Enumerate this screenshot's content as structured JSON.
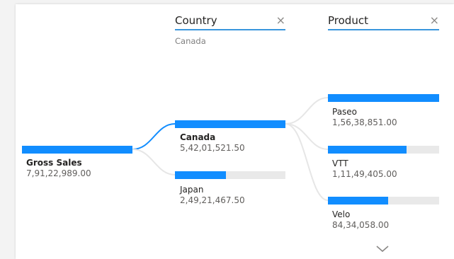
{
  "columns": [
    {
      "title": "Country",
      "close_symbol": "×",
      "filter_value": "Canada"
    },
    {
      "title": "Product",
      "close_symbol": "×"
    }
  ],
  "root": {
    "label": "Gross Sales",
    "value": "7,91,22,989.00",
    "fill_fraction": 1.0
  },
  "country_nodes": [
    {
      "label": "Canada",
      "value": "5,42,01,521.50",
      "fill_fraction": 1.0,
      "selected": true
    },
    {
      "label": "Japan",
      "value": "2,49,21,467.50",
      "fill_fraction": 0.46,
      "selected": false
    }
  ],
  "product_nodes": [
    {
      "label": "Paseo",
      "value": "1,56,38,851.00",
      "fill_fraction": 1.0
    },
    {
      "label": "VTT",
      "value": "1,11,49,405.00",
      "fill_fraction": 0.71
    },
    {
      "label": "Velo",
      "value": "84,34,058.00",
      "fill_fraction": 0.54
    }
  ],
  "colors": {
    "bar_fill": "#118dff",
    "bar_track": "#e9e9e9",
    "link_active": "#118dff",
    "link_inactive": "#e6e6e6",
    "header_underline": "#3a96dd"
  },
  "icons": {
    "close": "close-icon",
    "more": "chevron-down-icon"
  }
}
